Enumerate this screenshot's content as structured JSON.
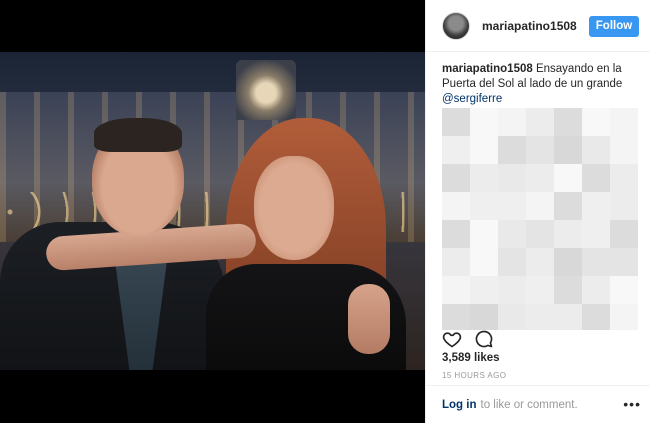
{
  "post": {
    "username": "mariapatino1508",
    "follow_label": "Follow",
    "caption_username": "mariapatino1508",
    "caption_text": "Ensayando en la Puerta del Sol al lado de un grande",
    "caption_mention": "@sergiferre",
    "likes": "3,589 likes",
    "timestamp": "15 HOURS AGO",
    "login_label": "Log in",
    "login_suffix": "to like or comment.",
    "more_icon_glyph": "•••"
  },
  "icons": {
    "like": "heart-icon",
    "comment": "comment-icon",
    "more": "more-options-icon"
  },
  "colors": {
    "accent": "#3897f0",
    "link": "#003569",
    "muted": "#999999",
    "text": "#262626"
  }
}
